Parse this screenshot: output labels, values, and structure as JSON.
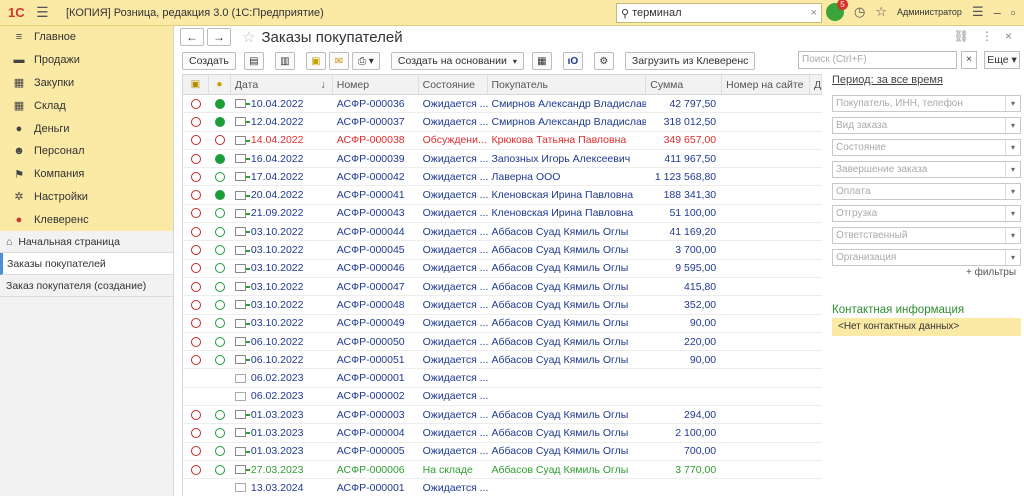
{
  "titlebar": {
    "logo": "1С",
    "title": "[КОПИЯ] Розница, редакция 3.0  (1С:Предприятие)",
    "search_value": "терминал",
    "notif_count": "5",
    "user": "Администратор"
  },
  "sections": [
    {
      "label": "Главное",
      "icon": "≡"
    },
    {
      "label": "Продажи",
      "icon": "▬"
    },
    {
      "label": "Закупки",
      "icon": "▦"
    },
    {
      "label": "Склад",
      "icon": "▦"
    },
    {
      "label": "Деньги",
      "icon": "●"
    },
    {
      "label": "Персонал",
      "icon": "☻"
    },
    {
      "label": "Компания",
      "icon": "⚑"
    },
    {
      "label": "Настройки",
      "icon": "✲"
    },
    {
      "label": "Клеверенс",
      "icon": "●"
    }
  ],
  "nav": [
    {
      "label": "Начальная страница"
    },
    {
      "label": "Заказы покупателей"
    },
    {
      "label": "Заказ покупателя (создание)"
    }
  ],
  "form": {
    "title": "Заказы покупателей",
    "toolbar": {
      "create": "Создать",
      "create_on_basis": "Создать на основании",
      "load_cleverence": "Загрузить из Клеверенс",
      "search_placeholder": "Поиск (Ctrl+F)",
      "more": "Еще"
    }
  },
  "table": {
    "headers": {
      "date": "Дата",
      "number": "Номер",
      "state": "Состояние",
      "buyer": "Покупатель",
      "sum": "Сумма",
      "site_number": "Номер на сайте",
      "extra": "Д"
    },
    "rows": [
      {
        "c1": "o-red",
        "c2": "f-green",
        "doc": "arrow",
        "date": "10.04.2022",
        "number": "АСФР-000036",
        "state": "Ожидается ...",
        "buyer": "Смирнов Александр Владиславо...",
        "sum": "42 797,50",
        "tone": "",
        "sel": false
      },
      {
        "c1": "o-red",
        "c2": "f-green",
        "doc": "arrow",
        "date": "12.04.2022",
        "number": "АСФР-000037",
        "state": "Ожидается ...",
        "buyer": "Смирнов Александр Владиславо...",
        "sum": "318 012,50",
        "tone": "",
        "sel": false
      },
      {
        "c1": "o-red",
        "c2": "o-red",
        "doc": "arrow",
        "date": "14.04.2022",
        "number": "АСФР-000038",
        "state": "Обсуждени...",
        "buyer": "Крюкова Татьяна Павловна",
        "sum": "349 657,00",
        "tone": "red",
        "sel": false
      },
      {
        "c1": "o-red",
        "c2": "f-green",
        "doc": "arrow",
        "date": "16.04.2022",
        "number": "АСФР-000039",
        "state": "Ожидается ...",
        "buyer": "Запозных Игорь Алексеевич",
        "sum": "411 967,50",
        "tone": "",
        "sel": false
      },
      {
        "c1": "o-red",
        "c2": "o-green",
        "doc": "arrow",
        "date": "17.04.2022",
        "number": "АСФР-000042",
        "state": "Ожидается ...",
        "buyer": "Лаверна ООО",
        "sum": "1 123 568,80",
        "tone": "",
        "sel": false
      },
      {
        "c1": "o-red",
        "c2": "f-green",
        "doc": "arrow",
        "date": "20.04.2022",
        "number": "АСФР-000041",
        "state": "Ожидается ...",
        "buyer": "Кленовская Ирина Павловна",
        "sum": "188 341,30",
        "tone": "",
        "sel": false
      },
      {
        "c1": "o-red",
        "c2": "o-green",
        "doc": "arrow",
        "date": "21.09.2022",
        "number": "АСФР-000043",
        "state": "Ожидается ...",
        "buyer": "Кленовская Ирина Павловна",
        "sum": "51 100,00",
        "tone": "",
        "sel": false
      },
      {
        "c1": "o-red",
        "c2": "o-green",
        "doc": "arrow",
        "date": "03.10.2022",
        "number": "АСФР-000044",
        "state": "Ожидается ...",
        "buyer": "Аббасов Суад Кямиль Оглы",
        "sum": "41 169,20",
        "tone": "",
        "sel": false
      },
      {
        "c1": "o-red",
        "c2": "o-green",
        "doc": "arrow",
        "date": "03.10.2022",
        "number": "АСФР-000045",
        "state": "Ожидается ...",
        "buyer": "Аббасов Суад Кямиль Оглы",
        "sum": "3 700,00",
        "tone": "",
        "sel": false
      },
      {
        "c1": "o-red",
        "c2": "o-green",
        "doc": "arrow",
        "date": "03.10.2022",
        "number": "АСФР-000046",
        "state": "Ожидается ...",
        "buyer": "Аббасов Суад Кямиль Оглы",
        "sum": "9 595,00",
        "tone": "",
        "sel": false
      },
      {
        "c1": "o-red",
        "c2": "o-green",
        "doc": "arrow",
        "date": "03.10.2022",
        "number": "АСФР-000047",
        "state": "Ожидается ...",
        "buyer": "Аббасов Суад Кямиль Оглы",
        "sum": "415,80",
        "tone": "",
        "sel": false
      },
      {
        "c1": "o-red",
        "c2": "o-green",
        "doc": "arrow",
        "date": "03.10.2022",
        "number": "АСФР-000048",
        "state": "Ожидается ...",
        "buyer": "Аббасов Суад Кямиль Оглы",
        "sum": "352,00",
        "tone": "",
        "sel": false
      },
      {
        "c1": "o-red",
        "c2": "o-green",
        "doc": "arrow",
        "date": "03.10.2022",
        "number": "АСФР-000049",
        "state": "Ожидается ...",
        "buyer": "Аббасов Суад Кямиль Оглы",
        "sum": "90,00",
        "tone": "",
        "sel": false
      },
      {
        "c1": "o-red",
        "c2": "o-green",
        "doc": "arrow",
        "date": "06.10.2022",
        "number": "АСФР-000050",
        "state": "Ожидается ...",
        "buyer": "Аббасов Суад Кямиль Оглы",
        "sum": "220,00",
        "tone": "",
        "sel": false
      },
      {
        "c1": "o-red",
        "c2": "o-green",
        "doc": "arrow",
        "date": "06.10.2022",
        "number": "АСФР-000051",
        "state": "Ожидается ...",
        "buyer": "Аббасов Суад Кямиль Оглы",
        "sum": "90,00",
        "tone": "",
        "sel": false
      },
      {
        "c1": "",
        "c2": "",
        "doc": "plain",
        "date": "06.02.2023",
        "number": "АСФР-000001",
        "state": "Ожидается ...",
        "buyer": "",
        "sum": "",
        "tone": "",
        "sel": false
      },
      {
        "c1": "",
        "c2": "",
        "doc": "plain",
        "date": "06.02.2023",
        "number": "АСФР-000002",
        "state": "Ожидается ...",
        "buyer": "",
        "sum": "",
        "tone": "",
        "sel": false
      },
      {
        "c1": "o-red",
        "c2": "o-green",
        "doc": "arrow",
        "date": "01.03.2023",
        "number": "АСФР-000003",
        "state": "Ожидается ...",
        "buyer": "Аббасов Суад Кямиль Оглы",
        "sum": "294,00",
        "tone": "",
        "sel": false
      },
      {
        "c1": "o-red",
        "c2": "o-green",
        "doc": "arrow",
        "date": "01.03.2023",
        "number": "АСФР-000004",
        "state": "Ожидается ...",
        "buyer": "Аббасов Суад Кямиль Оглы",
        "sum": "2 100,00",
        "tone": "",
        "sel": false
      },
      {
        "c1": "o-red",
        "c2": "o-green",
        "doc": "arrow",
        "date": "01.03.2023",
        "number": "АСФР-000005",
        "state": "Ожидается ...",
        "buyer": "Аббасов Суад Кямиль Оглы",
        "sum": "700,00",
        "tone": "",
        "sel": false
      },
      {
        "c1": "o-red",
        "c2": "o-green",
        "doc": "arrow",
        "date": "27.03.2023",
        "number": "АСФР-000006",
        "state": "На складе",
        "buyer": "Аббасов Суад Кямиль Оглы",
        "sum": "3 770,00",
        "tone": "green",
        "sel": false
      },
      {
        "c1": "",
        "c2": "",
        "doc": "plain",
        "date": "13.03.2024",
        "number": "АСФР-000001",
        "state": "Ожидается ...",
        "buyer": "",
        "sum": "",
        "tone": "",
        "sel": false
      }
    ]
  },
  "filters": {
    "period": "Период: за все время",
    "fields": [
      "Покупатель, ИНН, телефон",
      "Вид заказа",
      "Состояние",
      "Завершение заказа",
      "Оплата",
      "Отгрузка",
      "Ответственный",
      "Организация"
    ],
    "more_filters": "+ фильтры"
  },
  "contact": {
    "title": "Контактная информация",
    "value": "<Нет контактных данных>"
  },
  "colors": {
    "accent": "#fbe9a6",
    "link_blue": "#1f3a93",
    "red": "#e02c2c",
    "green": "#2f9e2f"
  }
}
